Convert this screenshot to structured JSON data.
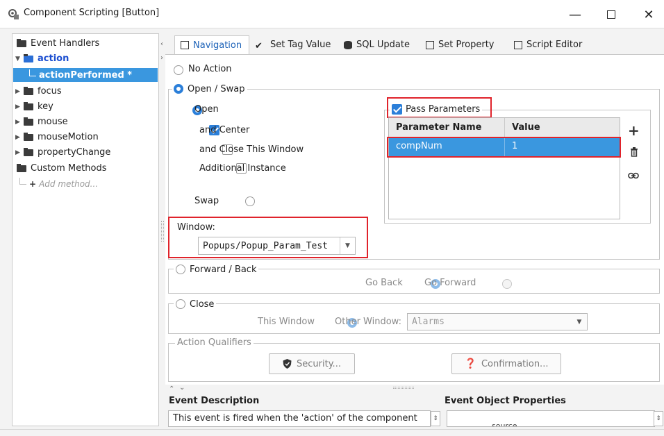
{
  "window": {
    "title": "Component Scripting [Button]"
  },
  "tree": {
    "event_handlers": "Event Handlers",
    "action": "action",
    "action_performed": "actionPerformed *",
    "items": [
      "focus",
      "key",
      "mouse",
      "mouseMotion",
      "propertyChange"
    ],
    "custom_methods": "Custom Methods",
    "add_method": "Add method..."
  },
  "tabs": [
    "Navigation",
    "Set Tag Value",
    "SQL Update",
    "Set Property",
    "Script Editor"
  ],
  "navigation": {
    "no_action": "No Action",
    "open_swap": "Open / Swap",
    "open": "Open",
    "and_center": "and Center",
    "and_close": "and Close This Window",
    "additional_instance": "Additional Instance",
    "swap": "Swap",
    "pass_parameters": "Pass Parameters",
    "param_headers": [
      "Parameter Name",
      "Value"
    ],
    "param_rows": [
      [
        "compNum",
        "1"
      ]
    ],
    "window_label": "Window:",
    "window_value": "Popups/Popup_Param_Test",
    "forward_back": "Forward / Back",
    "go_back": "Go Back",
    "go_forward": "Go Forward",
    "close": "Close",
    "this_window": "This Window",
    "other_window": "Other Window:",
    "other_window_value": "Alarms",
    "action_qualifiers": "Action Qualifiers",
    "security_button": "Security...",
    "confirmation_button": "Confirmation..."
  },
  "bottom": {
    "event_description_label": "Event Description",
    "event_description_text": "This event is fired when the 'action' of the component",
    "event_object_properties_label": "Event Object Properties",
    "event_object_partial": "source"
  },
  "colors": {
    "accent": "#2b7fd9",
    "selection": "#3a97df",
    "highlight": "#e0232b"
  }
}
